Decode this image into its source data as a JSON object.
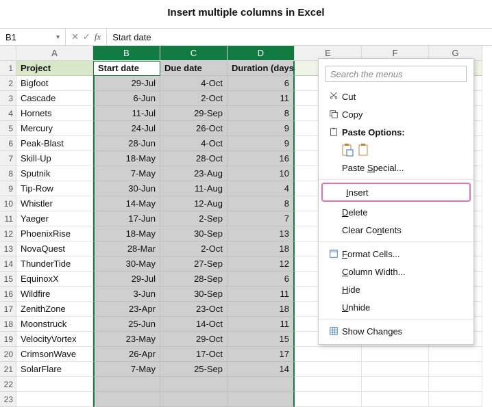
{
  "title": "Insert multiple columns in Excel",
  "formula_bar": {
    "name_box": "B1",
    "value": "Start date",
    "fx": "fx",
    "cancel": "✕",
    "accept": "✓"
  },
  "columns": [
    "A",
    "B",
    "C",
    "D",
    "E",
    "F",
    "G"
  ],
  "headers": {
    "A": "Project",
    "B": "Start date",
    "C": "Due date",
    "D": "Duration (days)"
  },
  "rows": [
    {
      "n": 2,
      "A": "Bigfoot",
      "B": "29-Jul",
      "C": "4-Oct",
      "D": "6"
    },
    {
      "n": 3,
      "A": "Cascade",
      "B": "6-Jun",
      "C": "2-Oct",
      "D": "11"
    },
    {
      "n": 4,
      "A": "Hornets",
      "B": "11-Jul",
      "C": "29-Sep",
      "D": "8"
    },
    {
      "n": 5,
      "A": "Mercury",
      "B": "24-Jul",
      "C": "26-Oct",
      "D": "9"
    },
    {
      "n": 6,
      "A": "Peak-Blast",
      "B": "28-Jun",
      "C": "4-Oct",
      "D": "9"
    },
    {
      "n": 7,
      "A": "Skill-Up",
      "B": "18-May",
      "C": "28-Oct",
      "D": "16"
    },
    {
      "n": 8,
      "A": "Sputnik",
      "B": "7-May",
      "C": "23-Aug",
      "D": "10"
    },
    {
      "n": 9,
      "A": "Tip-Row",
      "B": "30-Jun",
      "C": "11-Aug",
      "D": "4"
    },
    {
      "n": 10,
      "A": "Whistler",
      "B": "14-May",
      "C": "12-Aug",
      "D": "8"
    },
    {
      "n": 11,
      "A": "Yaeger",
      "B": "17-Jun",
      "C": "2-Sep",
      "D": "7"
    },
    {
      "n": 12,
      "A": "PhoenixRise",
      "B": "18-May",
      "C": "30-Sep",
      "D": "13"
    },
    {
      "n": 13,
      "A": "NovaQuest",
      "B": "28-Mar",
      "C": "2-Oct",
      "D": "18"
    },
    {
      "n": 14,
      "A": "ThunderTide",
      "B": "30-May",
      "C": "27-Sep",
      "D": "12"
    },
    {
      "n": 15,
      "A": "EquinoxX",
      "B": "29-Jul",
      "C": "28-Sep",
      "D": "6"
    },
    {
      "n": 16,
      "A": "Wildfire",
      "B": "3-Jun",
      "C": "30-Sep",
      "D": "11"
    },
    {
      "n": 17,
      "A": "ZenithZone",
      "B": "23-Apr",
      "C": "23-Oct",
      "D": "18"
    },
    {
      "n": 18,
      "A": "Moonstruck",
      "B": "25-Jun",
      "C": "14-Oct",
      "D": "11"
    },
    {
      "n": 19,
      "A": "VelocityVortex",
      "B": "23-May",
      "C": "29-Oct",
      "D": "15"
    },
    {
      "n": 20,
      "A": "CrimsonWave",
      "B": "26-Apr",
      "C": "17-Oct",
      "D": "17"
    },
    {
      "n": 21,
      "A": "SolarFlare",
      "B": "7-May",
      "C": "25-Sep",
      "D": "14"
    }
  ],
  "context_menu": {
    "search_placeholder": "Search the menus",
    "cut": "Cut",
    "copy": "Copy",
    "paste_options": "Paste Options:",
    "paste_special": "Paste Special...",
    "insert": "Insert",
    "delete": "Delete",
    "clear_contents": "Clear Contents",
    "format_cells": "Format Cells...",
    "column_width": "Column Width...",
    "hide": "Hide",
    "unhide": "Unhide",
    "show_changes": "Show Changes"
  }
}
